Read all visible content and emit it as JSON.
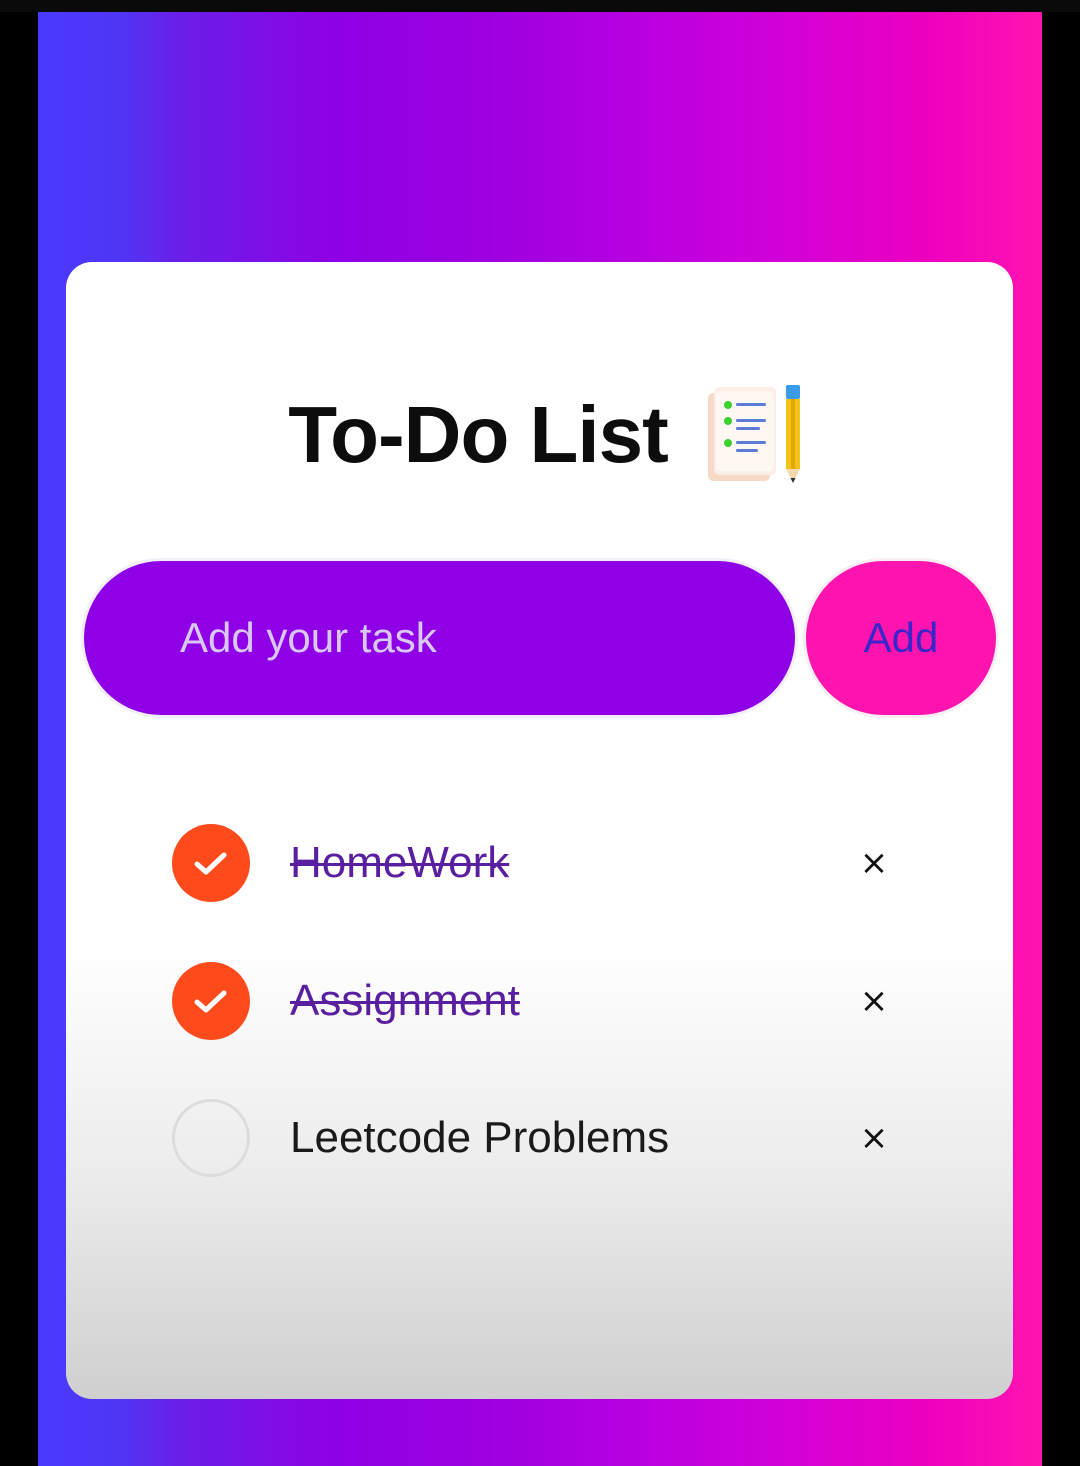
{
  "app": {
    "title": "To-Do List",
    "title_icon": "notepad-pencil-icon"
  },
  "input": {
    "placeholder": "Add your task",
    "value": ""
  },
  "add_button": {
    "label": "Add"
  },
  "tasks": [
    {
      "text": "HomeWork",
      "completed": true,
      "delete_label": "×"
    },
    {
      "text": "Assignment",
      "completed": true,
      "delete_label": "×"
    },
    {
      "text": "Leetcode Problems",
      "completed": false,
      "delete_label": "×"
    }
  ],
  "colors": {
    "input_bg": "#8f00e6",
    "add_button_bg": "#ff14b0",
    "add_button_text": "#3a26c8",
    "checked": "#ff4a1c",
    "completed_text": "#5a1fa0"
  },
  "icons": {
    "checked": "checkmark-icon",
    "delete": "close-icon"
  }
}
